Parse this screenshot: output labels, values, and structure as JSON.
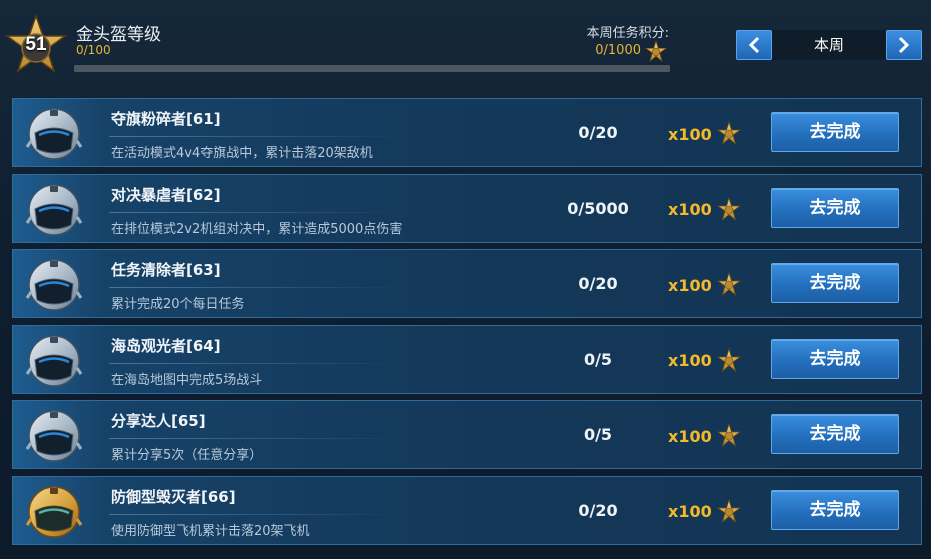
{
  "header": {
    "rank": "51",
    "level_title": "金头盔等级",
    "level_progress": "0/100",
    "level_fraction": 0,
    "weekly_label": "本周任务积分:",
    "weekly_value": "0/1000",
    "week_label": "本周",
    "icons": {
      "rank": "gold-star-badge-icon",
      "weekly": "star-medal-icon",
      "prev": "chevron-left-icon",
      "next": "chevron-right-icon"
    }
  },
  "tasks": [
    {
      "name": "夺旗粉碎者[61]",
      "desc": "在活动模式4v4夺旗战中，累计击落20架敌机",
      "progress": "0/20",
      "reward": "x100",
      "button": "去完成",
      "helmet": "silver-helmet-icon"
    },
    {
      "name": "对决暴虐者[62]",
      "desc": "在排位模式2v2机组对决中，累计造成5000点伤害",
      "progress": "0/5000",
      "reward": "x100",
      "button": "去完成",
      "helmet": "silver-helmet-icon"
    },
    {
      "name": "任务清除者[63]",
      "desc": "累计完成20个每日任务",
      "progress": "0/20",
      "reward": "x100",
      "button": "去完成",
      "helmet": "silver-helmet-icon"
    },
    {
      "name": "海岛观光者[64]",
      "desc": "在海岛地图中完成5场战斗",
      "progress": "0/5",
      "reward": "x100",
      "button": "去完成",
      "helmet": "silver-helmet-icon"
    },
    {
      "name": "分享达人[65]",
      "desc": "累计分享5次（任意分享）",
      "progress": "0/5",
      "reward": "x100",
      "button": "去完成",
      "helmet": "silver-helmet-icon"
    },
    {
      "name": "防御型毁灭者[66]",
      "desc": "使用防御型飞机累计击落20架飞机",
      "progress": "0/20",
      "reward": "x100",
      "button": "去完成",
      "helmet": "gold-helmet-icon"
    }
  ],
  "colors": {
    "gold": "#e4b43a",
    "button_blue": "#2470bd",
    "row_bg": "#14395b"
  }
}
